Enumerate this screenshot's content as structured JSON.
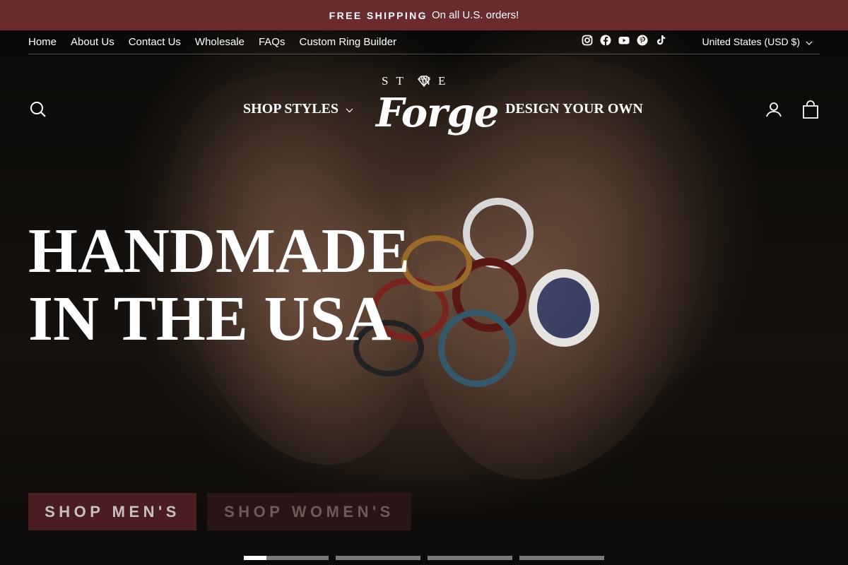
{
  "announcement": {
    "bold": "FREE SHIPPING",
    "text": "On all U.S. orders!"
  },
  "utility_nav": {
    "links": [
      "Home",
      "About Us",
      "Contact Us",
      "Wholesale",
      "FAQs",
      "Custom Ring Builder"
    ],
    "social_icons": [
      "instagram-icon",
      "facebook-icon",
      "youtube-icon",
      "pinterest-icon",
      "tiktok-icon"
    ],
    "currency": "United States (USD $)"
  },
  "header": {
    "shop_styles": "SHOP STYLES",
    "design_own": "DESIGN YOUR OWN",
    "logo_top": "ST NE",
    "logo_script": "Forge"
  },
  "hero": {
    "headline_line1": "HANDMADE",
    "headline_line2": "IN THE USA",
    "shop_mens": "SHOP MEN'S",
    "shop_womens": "SHOP WOMEN'S",
    "slide_count": 4,
    "active_slide": 1
  },
  "colors": {
    "announcement_bg": "#6a2b2e",
    "button_men_bg": "#4a1e21",
    "button_women_bg": "#2a1516"
  }
}
